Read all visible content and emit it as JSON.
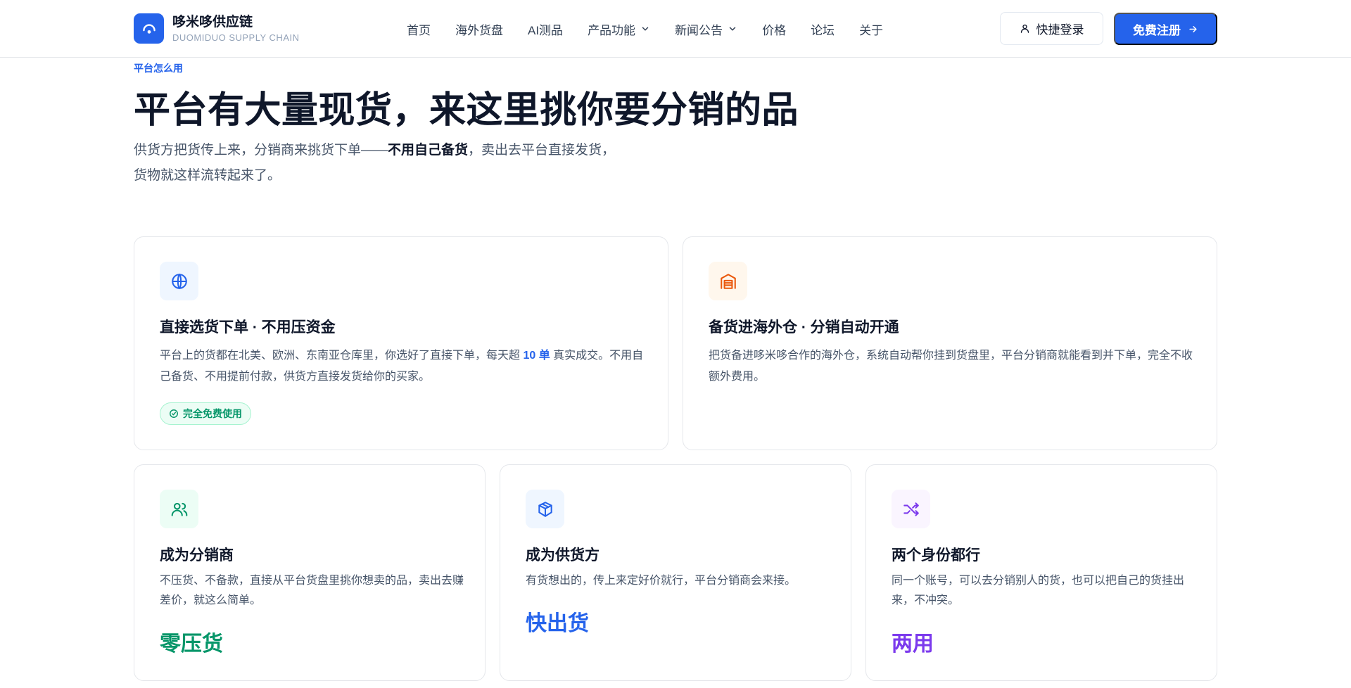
{
  "brand": {
    "name": "哆米哆供应链",
    "subtitle": "DUOMIDUO SUPPLY CHAIN"
  },
  "nav": {
    "items": [
      {
        "label": "首页"
      },
      {
        "label": "海外货盘"
      },
      {
        "label": "AI测品"
      },
      {
        "label": "产品功能"
      },
      {
        "label": "新闻公告"
      },
      {
        "label": "价格"
      },
      {
        "label": "论坛"
      },
      {
        "label": "关于"
      }
    ]
  },
  "header": {
    "login_label": "快捷登录",
    "register_label": "免费注册"
  },
  "intro": {
    "eyebrow": "平台怎么用",
    "headline": "平台有大量现货，来这里挑你要分销的品",
    "lead_before": "供货方把货传上来，分销商来挑货下单——",
    "lead_bold": "不用自己备货",
    "lead_after": "，卖出去平台直接发货，货物就这样流转起来了。"
  },
  "cards": [
    {
      "title": "直接选货下单 · 不用压资金",
      "desc_before": "平台上的货都在北美、欧洲、东南亚仓库里，你选好了直接下单，每天超 ",
      "desc_highlight": "10 单",
      "desc_after": " 真实成交。不用自己备货、不用提前付款，供货方直接发货给你的买家。",
      "badge": "完全免费使用",
      "icon": "globe-icon"
    },
    {
      "title": "备货进海外仓 · 分销自动开通",
      "desc": "把货备进哆米哆合作的海外仓，系统自动帮你挂到货盘里，平台分销商就能看到并下单，完全不收额外费用。",
      "icon": "warehouse-icon"
    },
    {
      "title": "成为分销商",
      "desc": "不压货、不备款，直接从平台货盘里挑你想卖的品，卖出去赚差价，就这么简单。",
      "stat": "零压货",
      "stat_color": "#059669",
      "icon": "users-icon"
    },
    {
      "title": "成为供货方",
      "desc": "有货想出的，传上来定好价就行，平台分销商会来接。",
      "stat": "快出货",
      "stat_color": "#2563eb",
      "icon": "package-icon"
    },
    {
      "title": "两个身份都行",
      "desc": "同一个账号，可以去分销别人的货，也可以把自己的货挂出来，不冲突。",
      "stat": "两用",
      "stat_color": "#7c3aed",
      "icon": "shuffle-icon"
    }
  ],
  "colors": {
    "primary": "#2563eb",
    "heading": "#0f172a",
    "body": "#475569",
    "green": "#059669",
    "orange": "#ea580c",
    "purple": "#7c3aed"
  }
}
